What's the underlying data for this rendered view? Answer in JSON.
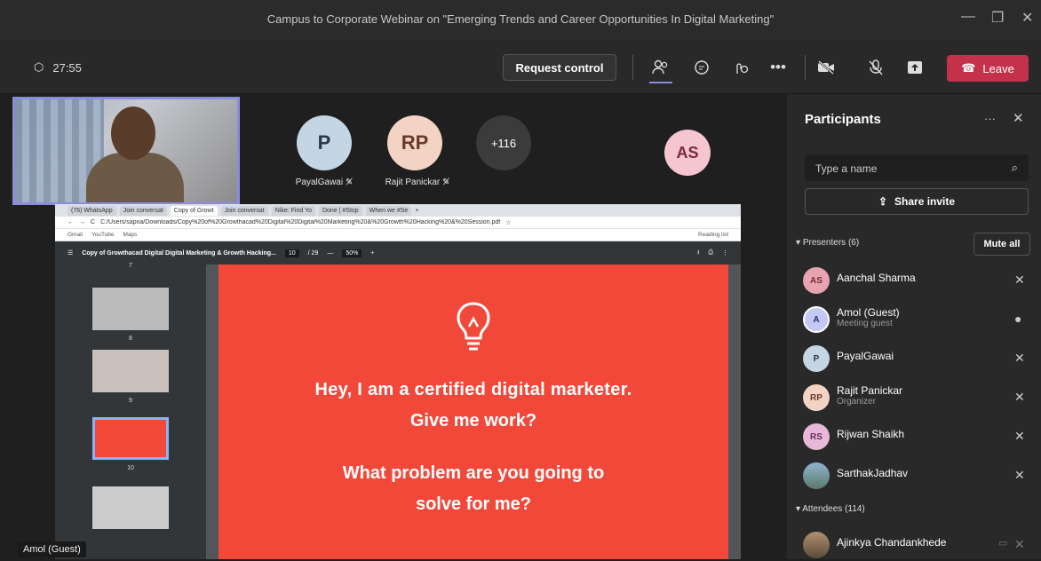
{
  "window": {
    "title": "Campus to Corporate Webinar on \"Emerging Trends and Career Opportunities In Digital Marketing\""
  },
  "toolbar": {
    "timer": "27:55",
    "request_control": "Request control",
    "leave": "Leave"
  },
  "stage": {
    "gallery": [
      {
        "initials": "P",
        "name": "PayalGawai"
      },
      {
        "initials": "RP",
        "name": "Rajit Panickar"
      },
      {
        "initials": "+116",
        "name": ""
      },
      {
        "initials": "AS",
        "name": ""
      }
    ],
    "self_label": "Amol (Guest)",
    "browser": {
      "tabs": [
        "(76) WhatsApp",
        "Join conversat",
        "Copy of Growt",
        "Join conversat",
        "Nike: Find Yo",
        "Done | #Stop",
        "When we #Se"
      ],
      "address": "C:/Users/sapna/Downloads/Copy%20of%20Growthacad%20Digital%20Digital%20Marketing%20&%20Growth%20Hacking%20&%20Session.pdf",
      "bookmarks": [
        "Gmail",
        "YouTube",
        "Maps"
      ],
      "reading_list": "Reading list",
      "pdf_title": "Copy of Growthacad Digital Digital Marketing & Growth Hacking...",
      "page": "10",
      "total_pages": "/ 29",
      "zoom": "50%",
      "thumb_numbers": [
        "7",
        "8",
        "9",
        "10"
      ],
      "slide_lines": [
        "Hey, I am a certified digital marketer.",
        "Give me work?",
        "What problem are you going to",
        "solve for me?"
      ]
    }
  },
  "panel": {
    "title": "Participants",
    "search_placeholder": "Type a name",
    "share_invite": "Share invite",
    "presenters_label": "Presenters (6)",
    "mute_all": "Mute all",
    "attendees_label": "Attendees (114)",
    "presenters": [
      {
        "initials": "AS",
        "name": "Aanchal Sharma",
        "role": "",
        "color": "#e8a3b2"
      },
      {
        "initials": "A",
        "name": "Amol (Guest)",
        "role": "Meeting guest",
        "color": "#c4c8f5"
      },
      {
        "initials": "P",
        "name": "PayalGawai",
        "role": "",
        "color": "#c4d6e4"
      },
      {
        "initials": "RP",
        "name": "Rajit Panickar",
        "role": "Organizer",
        "color": "#f2d3c4"
      },
      {
        "initials": "RS",
        "name": "Rijwan Shaikh",
        "role": "",
        "color": "#e8b8d8"
      },
      {
        "initials": "",
        "name": "SarthakJadhav",
        "role": "",
        "color": "#6a8aa0"
      }
    ],
    "attendees": [
      {
        "initials": "",
        "name": "Ajinkya Chandankhede",
        "color": "#7a6a5a"
      }
    ]
  }
}
